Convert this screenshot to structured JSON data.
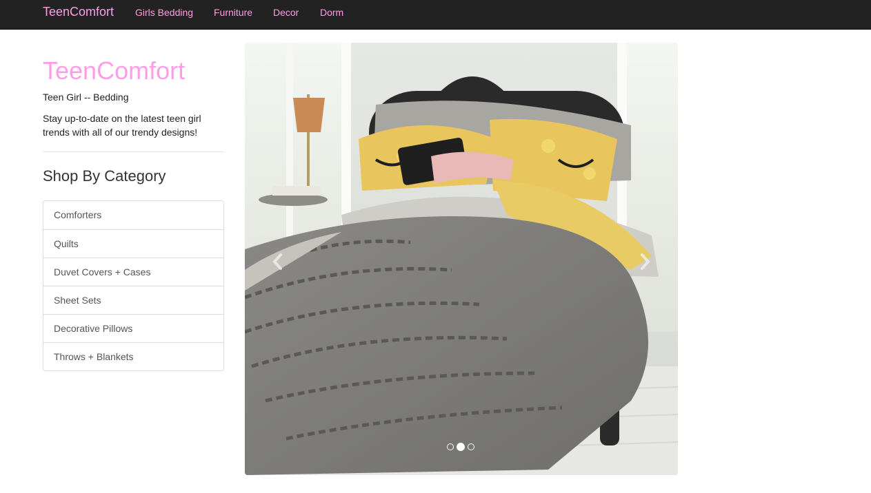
{
  "navbar": {
    "brand": "TeenComfort",
    "links": [
      "Girls Bedding",
      "Furniture",
      "Decor",
      "Dorm"
    ]
  },
  "sidebar": {
    "title": "TeenComfort",
    "subtitle": "Teen Girl -- Bedding",
    "description": "Stay up-to-date on the latest teen girl trends with all of our trendy designs!",
    "category_heading": "Shop By Category",
    "categories": [
      "Comforters",
      "Quilts",
      "Duvet Covers + Cases",
      "Sheet Sets",
      "Decorative Pillows",
      "Throws + Blankets"
    ]
  },
  "carousel": {
    "slide_count": 3,
    "active_index": 1,
    "prev_icon": "chevron-left-icon",
    "next_icon": "chevron-right-icon"
  },
  "colors": {
    "accent_pink": "#ff9ee6",
    "navbar_bg": "#222222"
  }
}
